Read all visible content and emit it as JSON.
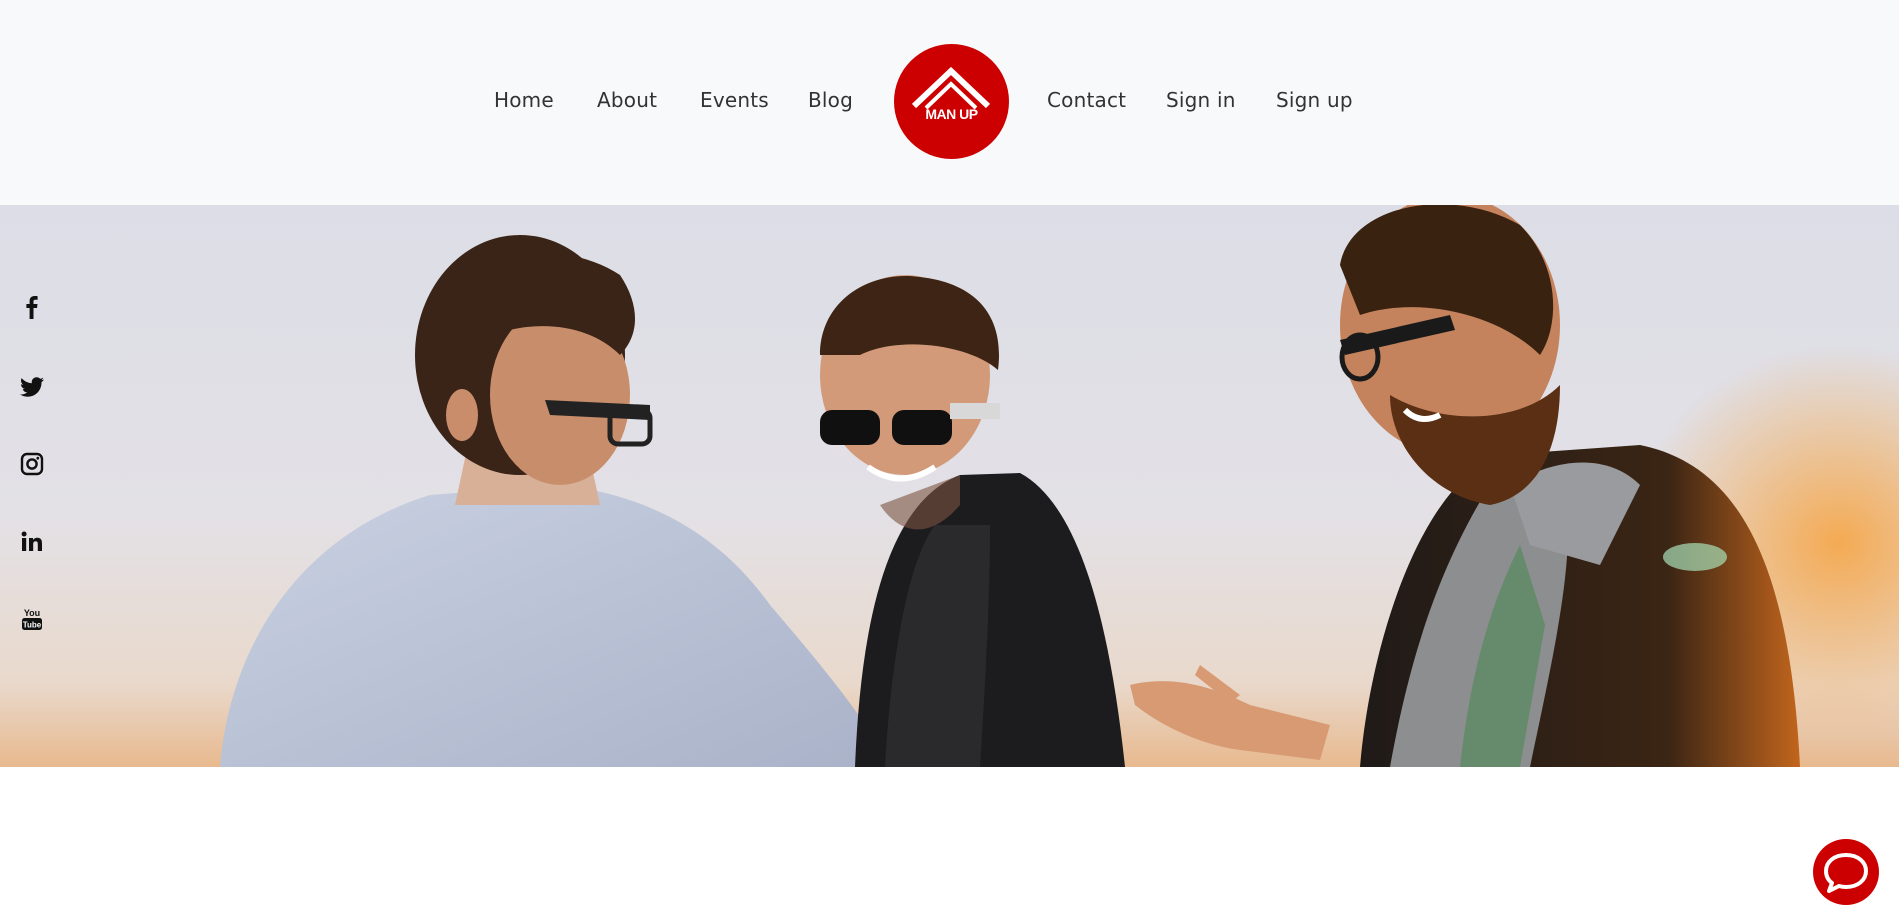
{
  "nav": {
    "home": "Home",
    "about": "About",
    "events": "Events",
    "blog": "Blog",
    "contact": "Contact",
    "sign_in": "Sign in",
    "sign_up": "Sign up"
  },
  "logo": {
    "text": "MAN UP",
    "icon": "roof-chevron-logo",
    "color": "#cc0000"
  },
  "hero": {
    "image": "three-men-laughing-at-sunset-photo"
  },
  "social": [
    {
      "icon": "facebook-icon"
    },
    {
      "icon": "twitter-icon"
    },
    {
      "icon": "instagram-icon"
    },
    {
      "icon": "linkedin-icon"
    },
    {
      "icon": "youtube-icon"
    }
  ],
  "chat": {
    "icon": "chat-bubble-icon",
    "color": "#cc0000"
  },
  "colors": {
    "header_bg": "#f8f9fa",
    "nav_text": "#333333",
    "accent": "#cc0000"
  }
}
